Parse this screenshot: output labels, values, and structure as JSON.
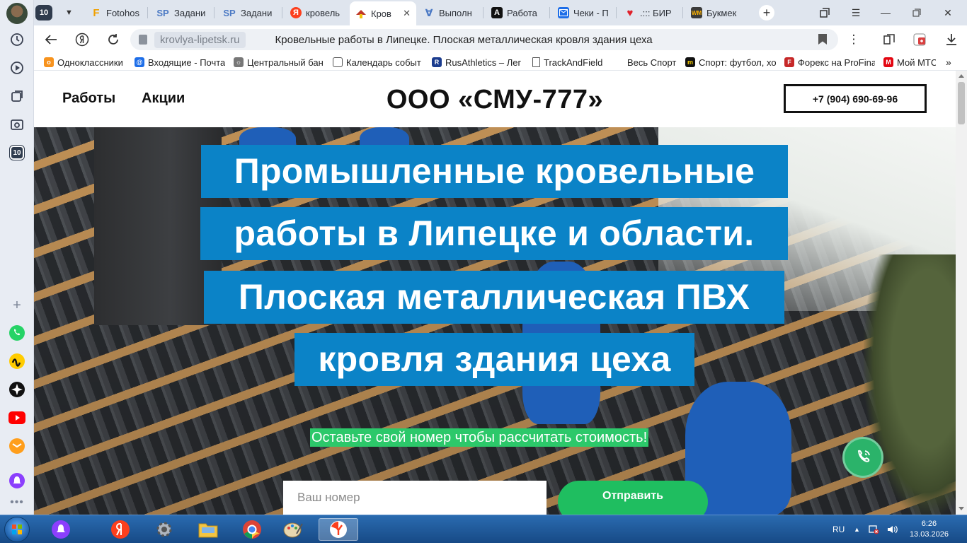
{
  "browser": {
    "tab_count_badge": "10",
    "tabs": [
      {
        "label": "Fotohos",
        "icon": "F"
      },
      {
        "label": "Задани",
        "icon": "SP"
      },
      {
        "label": "Задани",
        "icon": "SP"
      },
      {
        "label": "кровель",
        "icon": "Я"
      },
      {
        "label": "Кров",
        "icon": ""
      },
      {
        "label": "Выполн",
        "icon": "∀"
      },
      {
        "label": "Работа",
        "icon": "A"
      },
      {
        "label": "Чеки - П",
        "icon": ""
      },
      {
        "label": ".::: БИР",
        "icon": "♥"
      },
      {
        "label": "Букмек",
        "icon": "WM"
      }
    ],
    "address": {
      "host": "krovlya-lipetsk.ru",
      "page_title": "Кровельные работы в Липецке. Плоская металлическая кровля здания цеха"
    },
    "bookmarks": [
      "Одноклассники",
      "Входящие - Почта",
      "Центральный бан",
      "Календарь событ",
      "RusAthletics – Лег",
      "TrackAndField",
      "Весь Спорт",
      "Спорт: футбол, хо",
      "Форекс на ProFina",
      "Мой МТС"
    ]
  },
  "site": {
    "nav": {
      "works": "Работы",
      "promos": "Акции"
    },
    "brand": "ООО «СМУ-777»",
    "phone": "+7 (904) 690-69-96",
    "headline_lines": [
      "Промышленные кровельные",
      "работы в Липецке и области.",
      "Плоская металлическая ПВХ",
      "кровля здания цеха"
    ],
    "cta_text": "Оставьте свой номер чтобы рассчитать стоимость!",
    "phone_placeholder": "Ваш номер",
    "submit_label": "Отправить"
  },
  "taskbar": {
    "language": "RU",
    "time": "6:26",
    "date": "13.03.2026"
  },
  "colors": {
    "headline_bg": "#0b83c7",
    "cta_bg": "#2cc86a",
    "submit_bg": "#1fbe60",
    "call_bg": "#2bb36a"
  }
}
